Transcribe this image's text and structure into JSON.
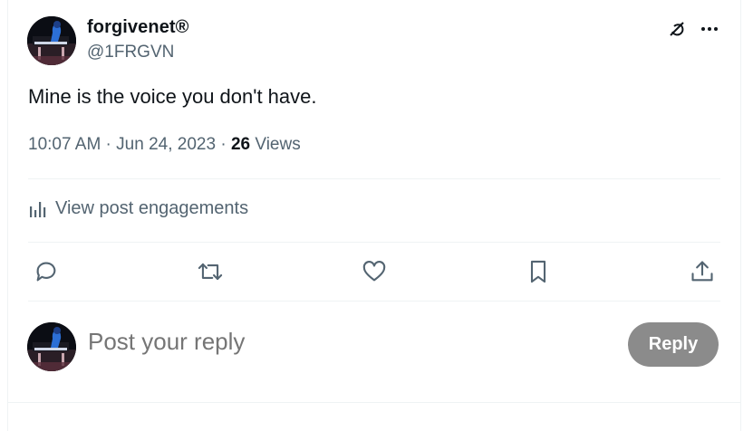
{
  "post": {
    "author": {
      "display_name": "forgivenet®",
      "handle": "@1FRGVN",
      "avatar_icon": "avatar-pianist-image"
    },
    "text": "Mine is the voice you don't have.",
    "timestamp": "10:07 AM · Jun 24, 2023",
    "separator": " · ",
    "views_count": "26",
    "views_label": "Views",
    "engagements_label": "View post engagements",
    "top_icons": [
      "grok-icon",
      "more-icon"
    ],
    "actions": [
      "reply-icon",
      "repost-icon",
      "like-icon",
      "bookmark-icon",
      "share-icon"
    ]
  },
  "reply_box": {
    "placeholder": "Post your reply",
    "button_label": "Reply"
  },
  "colors": {
    "text_primary": "#0f1419",
    "text_secondary": "#536471",
    "divider": "#eff3f4",
    "reply_button_disabled": "#8b8b8b"
  }
}
